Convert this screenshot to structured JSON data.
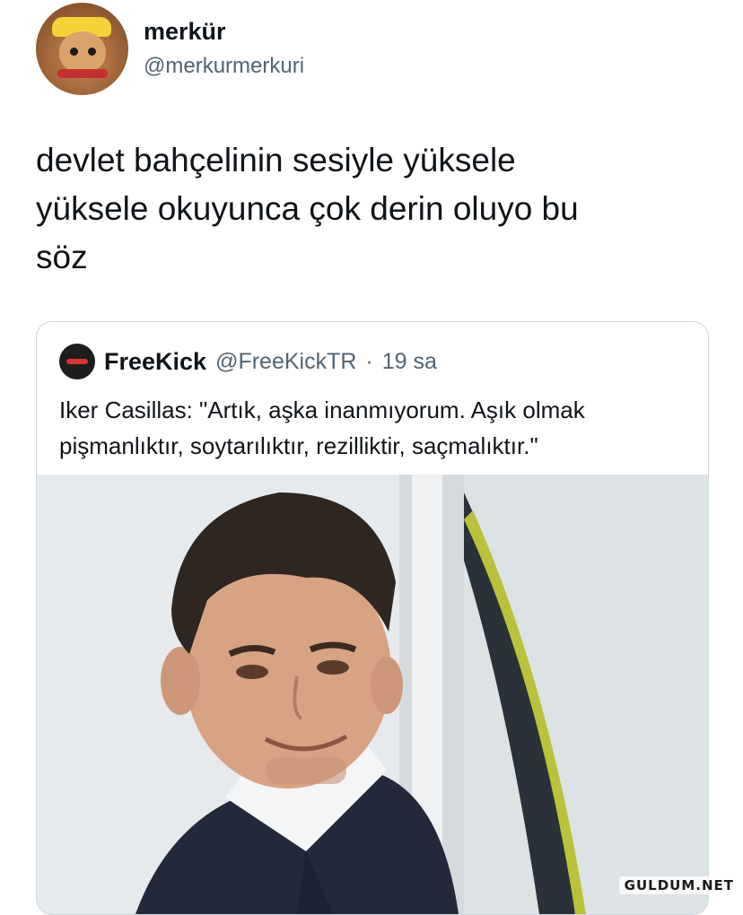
{
  "tweet": {
    "user": {
      "name": "merkür",
      "handle": "@merkurmerkuri",
      "avatar_icon": "cat-avatar"
    },
    "text_lines": [
      "devlet bahçelinin sesiyle yüksele",
      "yüksele okuyunca çok derin oluyo bu",
      "söz"
    ]
  },
  "quoted": {
    "user": {
      "name": "FreeKick",
      "handle": "@FreeKickTR",
      "time_separator": "·",
      "time": "19 sa",
      "avatar_icon": "freekick-logo-icon"
    },
    "text_lines": [
      "Iker Casillas: \"Artık, aşka inanmıyorum. Aşık olmak",
      "pişmanlıktır, soytarılıktır, rezilliktir, saçmalıktır.\""
    ]
  },
  "watermark": "GULDUM.NET"
}
